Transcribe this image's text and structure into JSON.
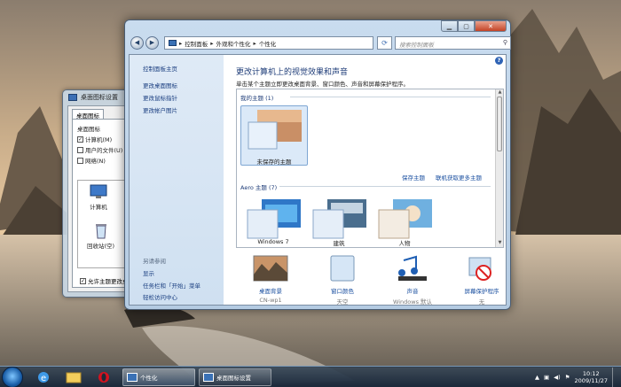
{
  "back_window": {
    "title": "桌面图标设置",
    "tab": "桌面图标",
    "group_label": "桌面图标",
    "checkboxes": [
      {
        "label": "计算机(M)",
        "checked": "✓"
      },
      {
        "label": "用户的文件(U)",
        "checked": ""
      },
      {
        "label": "网络(N)",
        "checked": ""
      }
    ],
    "desktop_icons": [
      "计算机",
      "回收站(空)"
    ],
    "allow_themes": "允许主题更改桌面图标"
  },
  "main_window": {
    "breadcrumb": [
      "控制面板",
      "外观和个性化",
      "个性化"
    ],
    "search_placeholder": "搜索控制面板",
    "left_links": [
      "控制面板主页",
      "更改桌面图标",
      "更改鼠标指针",
      "更改帐户图片"
    ],
    "see_also_header": "另请参阅",
    "see_also_links": [
      "显示",
      "任务栏和「开始」菜单",
      "轻松访问中心"
    ],
    "heading": "更改计算机上的视觉效果和声音",
    "subheading": "单击某个主题立即更改桌面背景、窗口颜色、声音和屏幕保护程序。",
    "my_themes_label": "我的主题 (1)",
    "unsaved_theme": "未保存的主题",
    "save_theme": "保存主题",
    "get_more_themes": "联机获取更多主题",
    "aero_label": "Aero 主题 (7)",
    "aero_partial_names": [
      "Windows 7",
      "建筑",
      "人物"
    ],
    "bottom_items": [
      {
        "label": "桌面背景",
        "value": "CN-wp1"
      },
      {
        "label": "窗口颜色",
        "value": "天空"
      },
      {
        "label": "声音",
        "value": "Windows 默认"
      },
      {
        "label": "屏幕保护程序",
        "value": "无"
      }
    ]
  },
  "taskbar": {
    "tasks": [
      "个性化",
      "桌面图标设置"
    ],
    "time": "10:12",
    "date": "2009/11/27"
  }
}
